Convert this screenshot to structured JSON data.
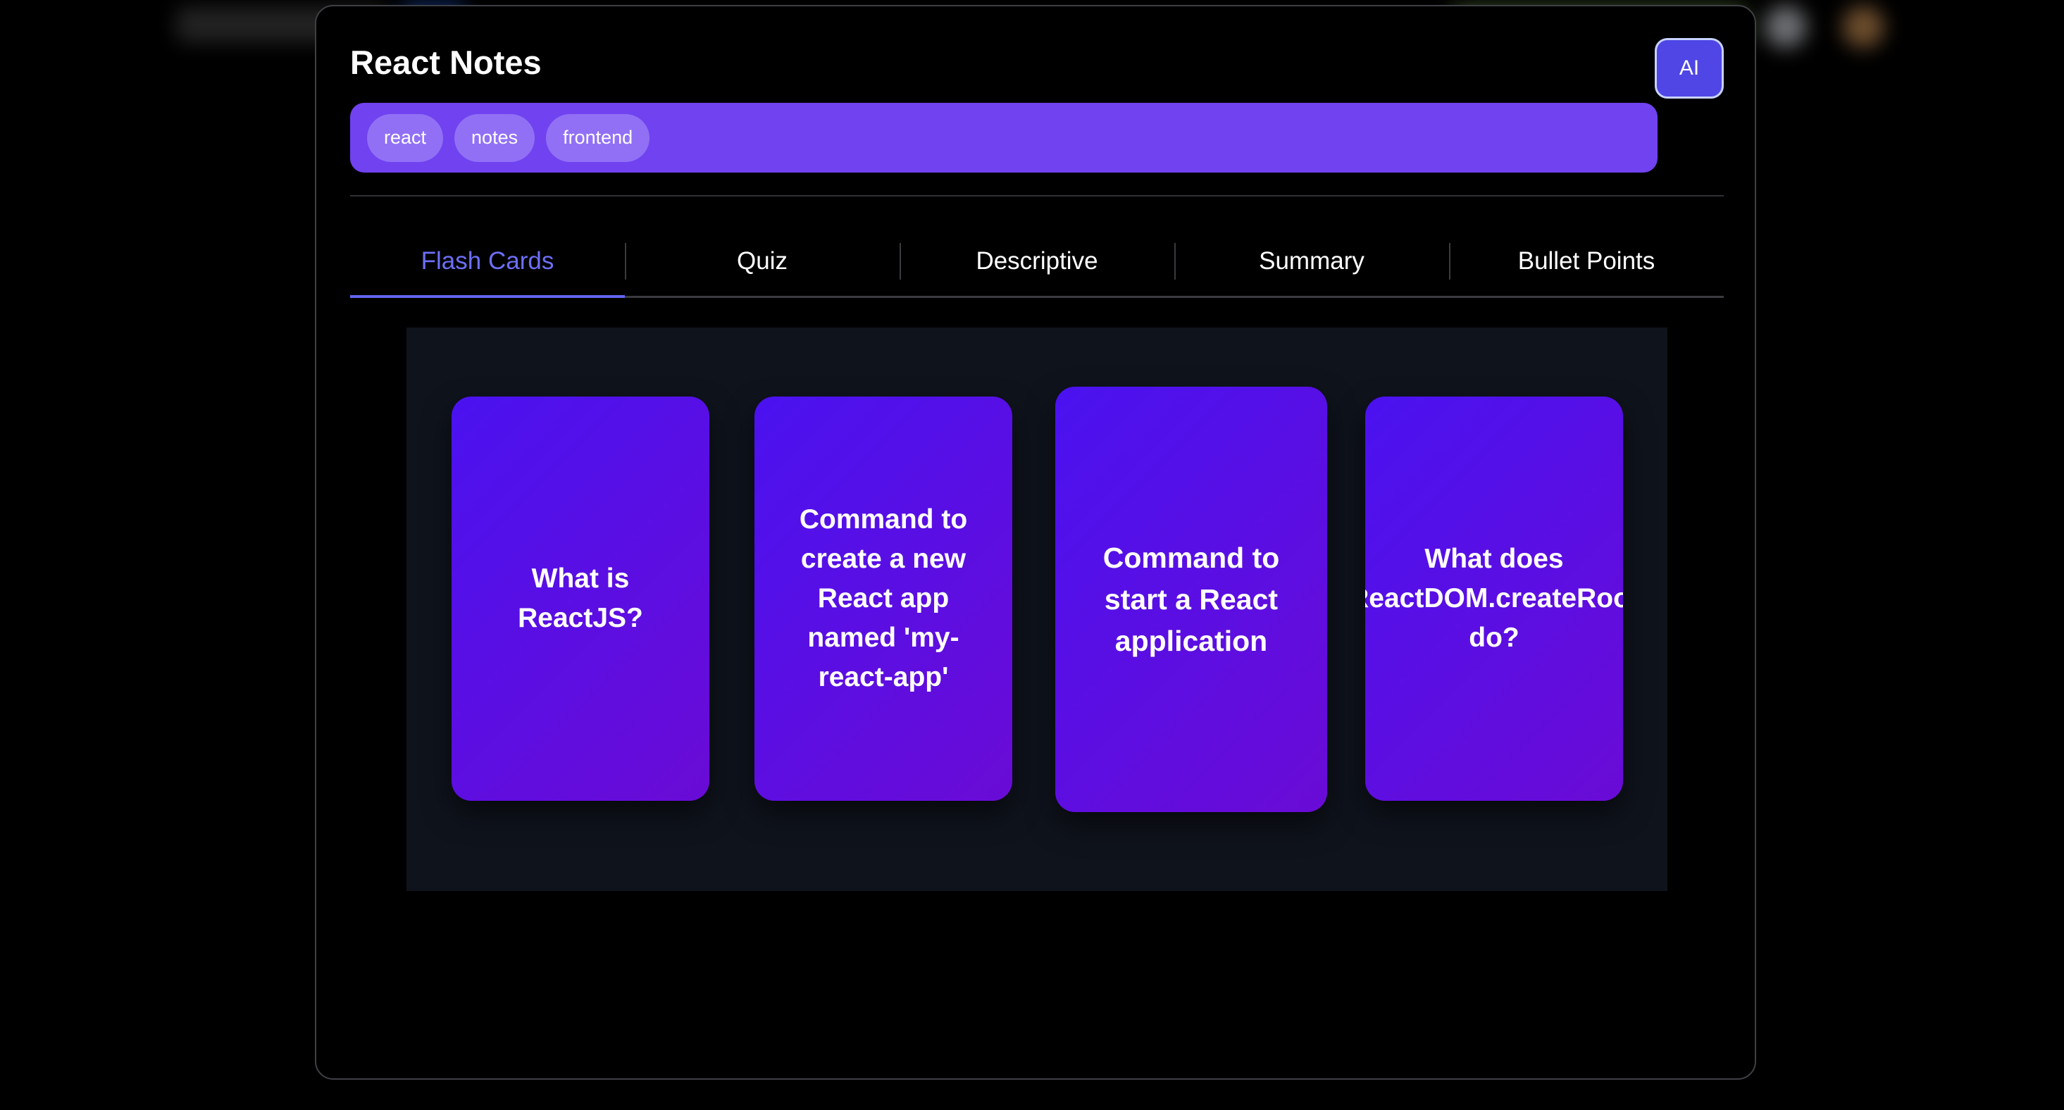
{
  "note": {
    "title": "React Notes",
    "ai_label": "AI",
    "tags": [
      "react",
      "notes",
      "frontend"
    ]
  },
  "tabs": [
    {
      "label": "Flash Cards",
      "active": true
    },
    {
      "label": "Quiz",
      "active": false
    },
    {
      "label": "Descriptive",
      "active": false
    },
    {
      "label": "Summary",
      "active": false
    },
    {
      "label": "Bullet Points",
      "active": false
    }
  ],
  "flash_cards": [
    {
      "question": "What is\nReactJS?"
    },
    {
      "question": "Command to\ncreate a new\nReact app\nnamed 'my-\nreact-app'"
    },
    {
      "question": "Command to\nstart a React\napplication"
    },
    {
      "question": "What does\nReactDOM.createRoot\ndo?"
    }
  ],
  "colors": {
    "accent": "#6366f1",
    "tag_bar": "#7042f0",
    "card_gradient_start": "#4a12f0",
    "card_gradient_end": "#6a0bd6"
  }
}
